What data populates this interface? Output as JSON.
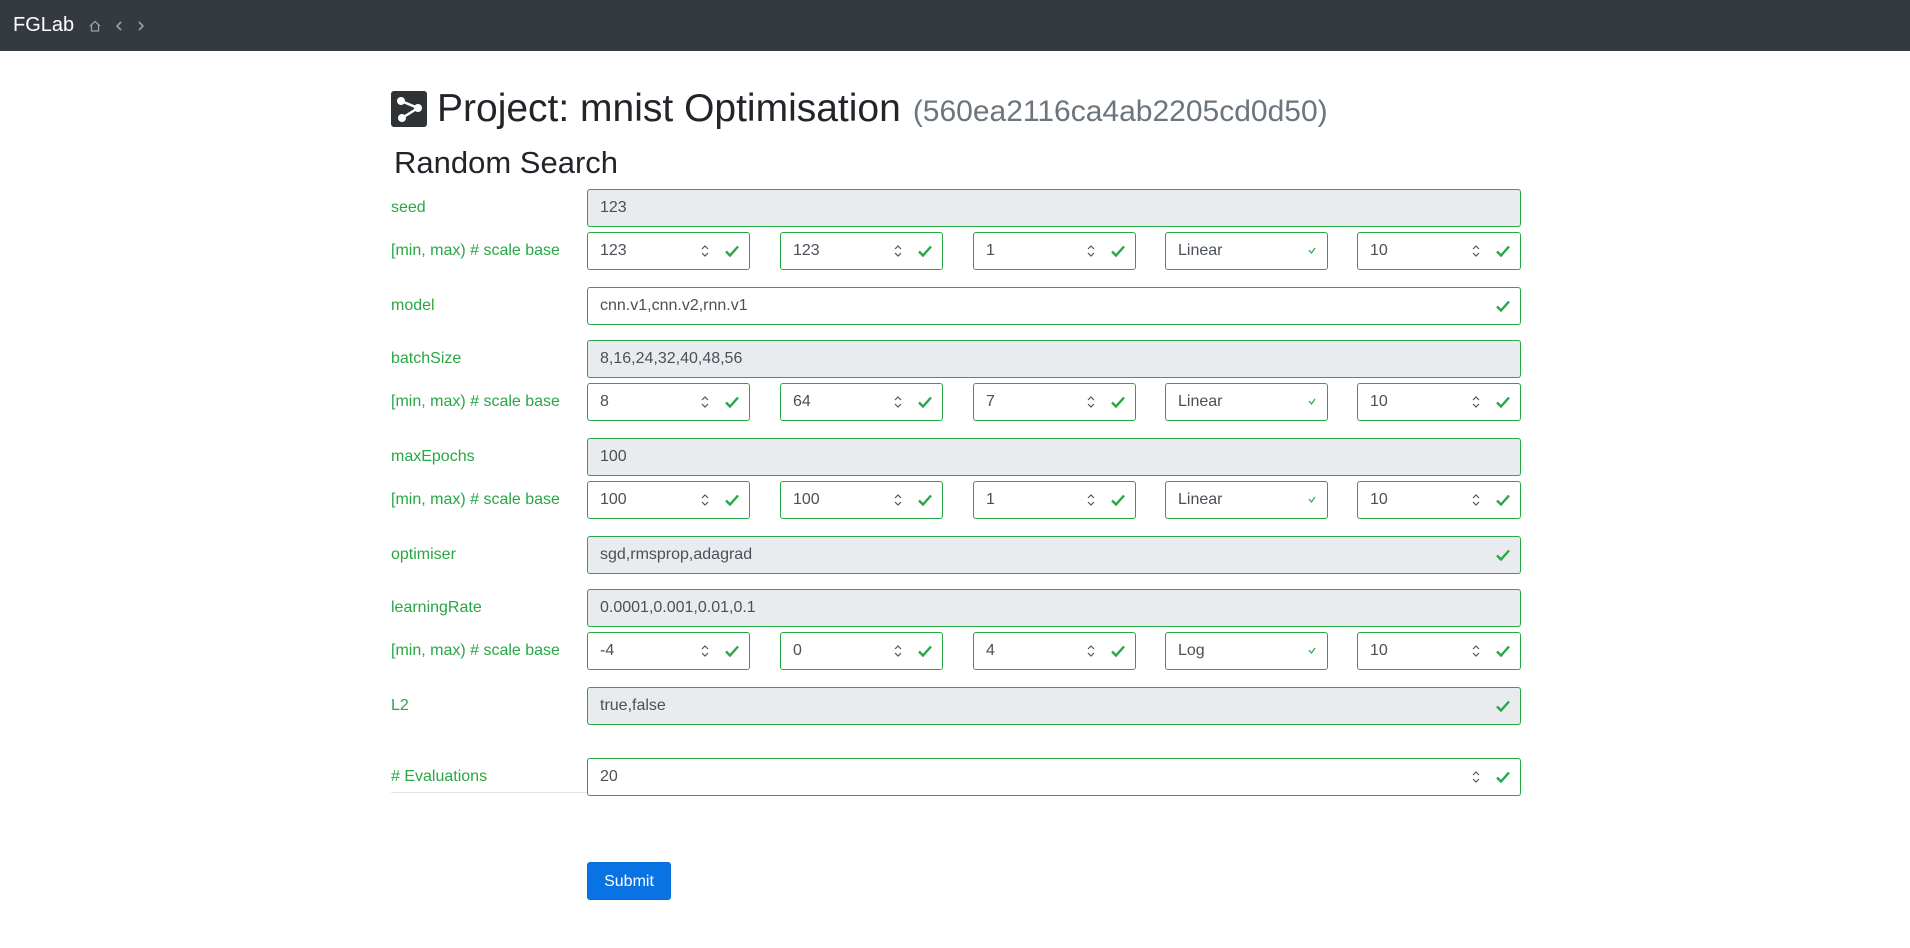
{
  "navbar": {
    "brand": "FGLab"
  },
  "page": {
    "title": "Project: mnist Optimisation",
    "project_id": "(560ea2116ca4ab2205cd0d50)",
    "section": "Random Search"
  },
  "range_label": "[min, max) # scale base",
  "params": {
    "seed": {
      "label": "seed",
      "value": "123",
      "min": "123",
      "max": "123",
      "count": "1",
      "scale": "Linear",
      "base": "10"
    },
    "model": {
      "label": "model",
      "value": "cnn.v1,cnn.v2,rnn.v1"
    },
    "batchSize": {
      "label": "batchSize",
      "value": "8,16,24,32,40,48,56",
      "min": "8",
      "max": "64",
      "count": "7",
      "scale": "Linear",
      "base": "10"
    },
    "maxEpochs": {
      "label": "maxEpochs",
      "value": "100",
      "min": "100",
      "max": "100",
      "count": "1",
      "scale": "Linear",
      "base": "10"
    },
    "optimiser": {
      "label": "optimiser",
      "value": "sgd,rmsprop,adagrad"
    },
    "learningRate": {
      "label": "learningRate",
      "value": "0.0001,0.001,0.01,0.1",
      "min": "-4",
      "max": "0",
      "count": "4",
      "scale": "Log",
      "base": "10"
    },
    "L2": {
      "label": "L2",
      "value": "true,false"
    }
  },
  "evaluations": {
    "label": "# Evaluations",
    "value": "20"
  },
  "submit_label": "Submit",
  "colors": {
    "valid": "#28a745",
    "primary": "#0a73e3",
    "navbar": "#343a40"
  }
}
